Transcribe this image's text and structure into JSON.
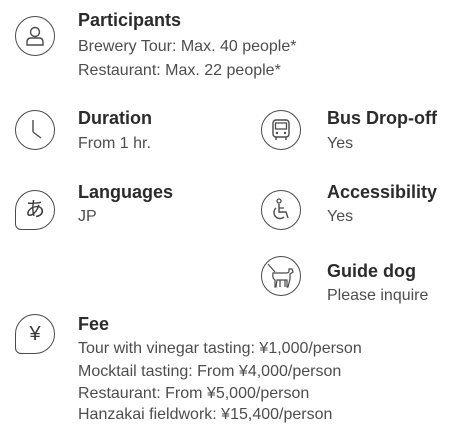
{
  "participants": {
    "title": "Participants",
    "lines": [
      "Brewery Tour: Max. 40 people*",
      "Restaurant: Max. 22 people*"
    ]
  },
  "duration": {
    "title": "Duration",
    "value": "From 1 hr."
  },
  "bus": {
    "title": "Bus Drop-off",
    "value": "Yes"
  },
  "languages": {
    "title": "Languages",
    "value": "JP",
    "icon_glyph": "あ"
  },
  "accessibility": {
    "title": "Accessibility",
    "value": "Yes"
  },
  "guide_dog": {
    "title": "Guide dog",
    "value": "Please inquire"
  },
  "fee": {
    "title": "Fee",
    "icon_glyph": "¥",
    "lines": [
      "Tour with vinegar tasting: ¥1,000/person",
      "Mocktail tasting: From ¥4,000/person",
      "Restaurant: From ¥5,000/person",
      "Hanzakai fieldwork: ¥15,400/person"
    ]
  },
  "icons": {
    "participants": "person-icon",
    "duration": "clock-icon",
    "bus": "bus-icon",
    "languages": "speech-bubble-icon",
    "accessibility": "wheelchair-icon",
    "guide_dog": "guide-dog-icon",
    "fee": "yen-icon"
  }
}
